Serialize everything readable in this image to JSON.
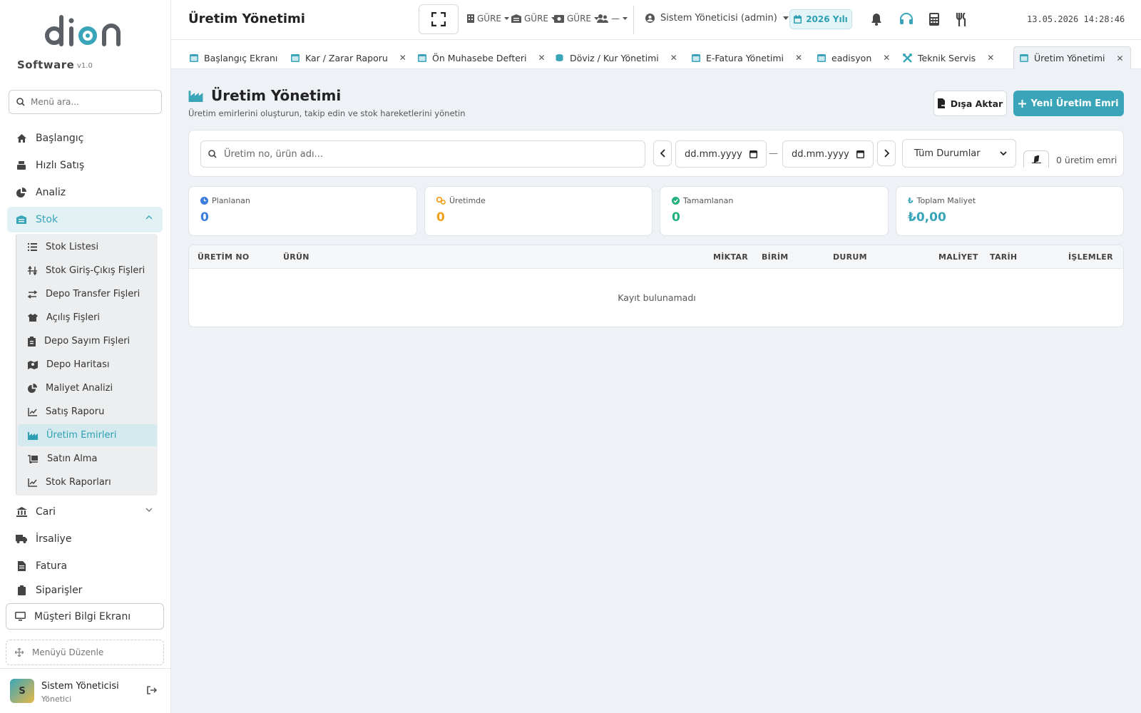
{
  "brand": {
    "logo_text": "dion",
    "name": "Software",
    "version": "v1.0"
  },
  "sidebar": {
    "search_placeholder": "Menü ara...",
    "items": [
      {
        "label": "Başlangıç",
        "icon": "home-icon"
      },
      {
        "label": "Hızlı Satış",
        "icon": "register-icon"
      },
      {
        "label": "Analiz",
        "icon": "pie-chart-icon"
      },
      {
        "label": "Stok",
        "icon": "warehouse-icon",
        "expanded": true
      },
      {
        "label": "Cari",
        "icon": "bank-icon"
      },
      {
        "label": "İrsaliye",
        "icon": "truck-icon"
      },
      {
        "label": "Fatura",
        "icon": "invoice-icon"
      },
      {
        "label": "Siparişler",
        "icon": "clipboard-icon"
      }
    ],
    "stok_submenu": [
      {
        "label": "Stok Listesi",
        "icon": "list-icon"
      },
      {
        "label": "Stok Giriş-Çıkış Fişleri",
        "icon": "arrows-vertical-icon"
      },
      {
        "label": "Depo Transfer Fişleri",
        "icon": "transfer-icon"
      },
      {
        "label": "Açılış Fişleri",
        "icon": "box-open-icon"
      },
      {
        "label": "Depo Sayım Fişleri",
        "icon": "clipboard-check-icon"
      },
      {
        "label": "Depo Haritası",
        "icon": "map-icon"
      },
      {
        "label": "Maliyet Analizi",
        "icon": "pie-chart-icon"
      },
      {
        "label": "Satış Raporu",
        "icon": "line-chart-icon"
      },
      {
        "label": "Üretim Emirleri",
        "icon": "factory-icon",
        "active": true
      },
      {
        "label": "Satın Alma",
        "icon": "dolly-icon"
      },
      {
        "label": "Stok Raporları",
        "icon": "line-chart-icon"
      }
    ],
    "customer_screen": "Müşteri Bilgi Ekranı",
    "edit_menu": "Menüyü Düzenle",
    "user": {
      "initial": "S",
      "name": "Sistem Yöneticisi",
      "role": "Yönetici"
    }
  },
  "topbar": {
    "title": "Üretim Yönetimi",
    "selects": [
      "GÜRE",
      "GÜRE",
      "GÜRE",
      "—"
    ],
    "user_select": "Sistem Yöneticisi (admin)",
    "year": "2026 Yılı",
    "datetime": "13.05.2026 14:28:46"
  },
  "tabs": [
    {
      "label": "Başlangıç Ekranı",
      "closable": false
    },
    {
      "label": "Kar / Zarar Raporu",
      "closable": true
    },
    {
      "label": "Ön Muhasebe Defteri",
      "closable": true
    },
    {
      "label": "Döviz / Kur Yönetimi",
      "closable": true
    },
    {
      "label": "E-Fatura Yönetimi",
      "closable": true
    },
    {
      "label": "eadisyon",
      "closable": true
    },
    {
      "label": "Teknik Servis",
      "closable": true
    },
    {
      "label": "Üretim Yönetimi",
      "closable": true,
      "active": true
    }
  ],
  "page": {
    "title": "Üretim Yönetimi",
    "subtitle": "Üretim emirlerini oluşturun, takip edin ve stok hareketlerini yönetin",
    "export_label": "Dışa Aktar",
    "new_label": "Yeni Üretim Emri"
  },
  "filters": {
    "search_placeholder": "Üretim no, ürün adı...",
    "date_start": "dd.mm.yyyy",
    "date_end": "dd.mm.yyyy",
    "date_separator": "—",
    "status": "Tüm Durumlar",
    "count": "0 üretim emri"
  },
  "stats": [
    {
      "label": "Planlanan",
      "value": "0",
      "color": "#3b7ddd"
    },
    {
      "label": "Üretimde",
      "value": "0",
      "color": "#f0a020"
    },
    {
      "label": "Tamamlanan",
      "value": "0",
      "color": "#22b07d"
    },
    {
      "label": "Toplam Maliyet",
      "value": "₺0,00",
      "color": "#3aa5b8"
    }
  ],
  "table": {
    "columns": [
      "ÜRETİM NO",
      "ÜRÜN",
      "MİKTAR",
      "BİRİM",
      "DURUM",
      "MALİYET",
      "TARİH",
      "İŞLEMLER"
    ],
    "empty_text": "Kayıt bulunamadı"
  },
  "colors": {
    "accent": "#3aa5b8",
    "accent_light": "#e2f1f4"
  }
}
